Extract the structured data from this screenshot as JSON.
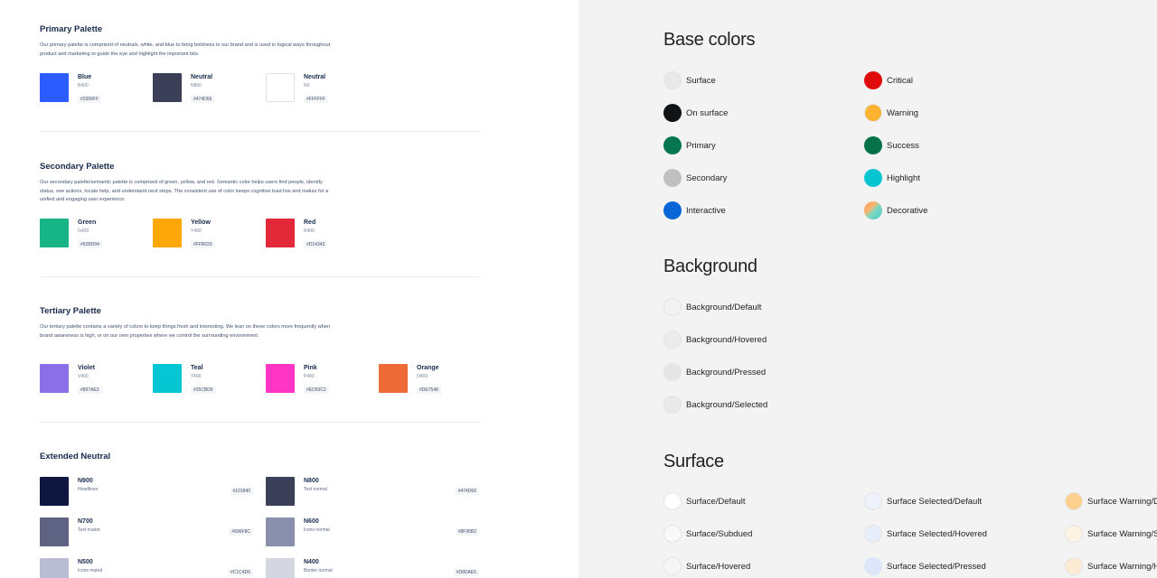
{
  "primary": {
    "title": "Primary Palette",
    "desc": "Our primary palette is comprised of neutrals, white, and blue to bring boldness to our brand and is used in logical ways throughout product and marketing to guide the eye and highlight the important bits.",
    "swatches": [
      {
        "name": "Blue",
        "code": "B400",
        "hex": "#3366FF",
        "color": "#2b5cff"
      },
      {
        "name": "Neutral",
        "code": "N800",
        "hex": "#474D66",
        "color": "#3c3f58"
      },
      {
        "name": "Neutral",
        "code": "N0",
        "hex": "#FFFFFF",
        "color": "#ffffff"
      }
    ]
  },
  "secondary": {
    "title": "Secondary Palette",
    "desc": "Our secondary palette/semantic palette is comprised of green, yellow, and red. Semantic color helps users find people, identify status, see actions, locate help, and understand next steps. The consistent use of color keeps cognitive load low and makes for a unified and engaging user experience.",
    "swatches": [
      {
        "name": "Green",
        "code": "G400",
        "hex": "#52BD94",
        "color": "#17b585"
      },
      {
        "name": "Yellow",
        "code": "Y400",
        "hex": "#FFB020",
        "color": "#fda708"
      },
      {
        "name": "Red",
        "code": "R400",
        "hex": "#D14343",
        "color": "#e3283a"
      }
    ]
  },
  "tertiary": {
    "title": "Tertiary Palette",
    "desc": "Our tertiary palette contains a variety of colors to keep things fresh and interesting. We lean on these colors more frequently when brand awareness is high, or on our own properties where we control the surrounding environment.",
    "swatches": [
      {
        "name": "Violet",
        "code": "V400",
        "hex": "#897AE3",
        "color": "#8b6fe8"
      },
      {
        "name": "Teal",
        "code": "T400",
        "hex": "#25CBD6",
        "color": "#07c6d4"
      },
      {
        "name": "Pink",
        "code": "P400",
        "hex": "#ED55C2",
        "color": "#ff35c6"
      },
      {
        "name": "Orange",
        "code": "O400",
        "hex": "#DE7548",
        "color": "#ee6a37"
      }
    ]
  },
  "extended": {
    "title": "Extended Neutral",
    "items": [
      {
        "name": "N900",
        "desc": "Headlines",
        "hex": "#101840",
        "color": "#0f1640"
      },
      {
        "name": "N800",
        "desc": "Text normal",
        "hex": "#474D66",
        "color": "#3c3f58"
      },
      {
        "name": "N700",
        "desc": "Text muted",
        "hex": "#696F8C",
        "color": "#5e6383"
      },
      {
        "name": "N600",
        "desc": "Icons normal",
        "hex": "#8F95B2",
        "color": "#8a8fae"
      },
      {
        "name": "N500",
        "desc": "Icons muted",
        "hex": "#C1C4D6",
        "color": "#b9bdd3"
      },
      {
        "name": "N400",
        "desc": "Border normal",
        "hex": "#D8DAE5",
        "color": "#d4d6e2"
      }
    ]
  },
  "base": {
    "title": "Base colors",
    "items": [
      {
        "label": "Surface",
        "color": "#e9e9e9"
      },
      {
        "label": "Critical",
        "color": "#e00b0b"
      },
      {
        "label": "On surface",
        "color": "#111213"
      },
      {
        "label": "Warning",
        "color": "#fdb32f"
      },
      {
        "label": "Primary",
        "color": "#067651"
      },
      {
        "label": "Success",
        "color": "#057148"
      },
      {
        "label": "Secondary",
        "color": "#c0c0c0"
      },
      {
        "label": "Highlight",
        "color": "#07c5d0"
      },
      {
        "label": "Interactive",
        "color": "#0866d6"
      },
      {
        "label": "Decorative",
        "color": "gradient"
      }
    ]
  },
  "background": {
    "title": "Background",
    "items": [
      {
        "label": "Background/Default",
        "color": "#f2f2f2"
      },
      {
        "label": "Background/Hovered",
        "color": "#ececec"
      },
      {
        "label": "Background/Pressed",
        "color": "#e6e6e6"
      },
      {
        "label": "Background/Selected",
        "color": "#e9e9e9"
      }
    ]
  },
  "surface": {
    "title": "Surface",
    "items": [
      {
        "label": "Surface/Default",
        "color": "#ffffff"
      },
      {
        "label": "Surface Selected/Default",
        "color": "#eef3fb"
      },
      {
        "label": "Surface Warning/Default",
        "color": "#fdd090"
      },
      {
        "label": "Surface/Subdued",
        "color": "#f9f9f9"
      },
      {
        "label": "Surface Selected/Hovered",
        "color": "#e6eefb"
      },
      {
        "label": "Surface Warning/Subdued",
        "color": "#fdf3e3"
      },
      {
        "label": "Surface/Hovered",
        "color": "#f5f5f5"
      },
      {
        "label": "Surface Selected/Pressed",
        "color": "#dce6f8"
      },
      {
        "label": "Surface Warning/Hovered",
        "color": "#fcecd4"
      }
    ]
  }
}
